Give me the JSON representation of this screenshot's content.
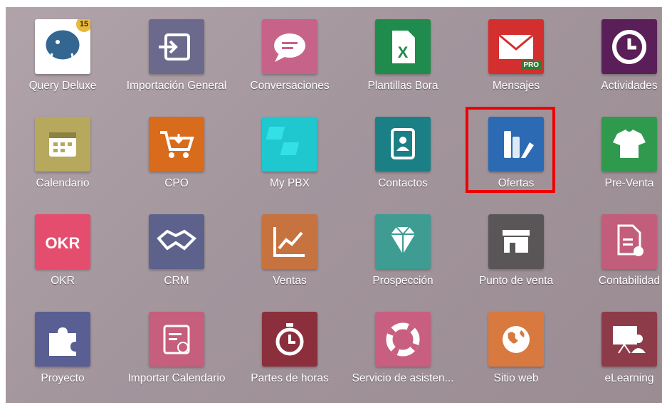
{
  "apps": [
    {
      "label": "Query Deluxe",
      "icon": "postgres-elephant-icon",
      "color": "#ffffff",
      "badge": "15"
    },
    {
      "label": "Importación General",
      "icon": "import-icon",
      "color": "#6b6a8d"
    },
    {
      "label": "Conversaciones",
      "icon": "chat-bubble-icon",
      "color": "#c76388"
    },
    {
      "label": "Plantillas Bora",
      "icon": "excel-file-icon",
      "color": "#1f8b4c"
    },
    {
      "label": "Mensajes",
      "icon": "envelope-icon",
      "color": "#d32f2f",
      "badge_text": "PRO"
    },
    {
      "label": "Actividades",
      "icon": "clock-icon",
      "color": "#5a1e58"
    },
    {
      "label": "Calendario",
      "icon": "calendar-icon",
      "color": "#b6a85d"
    },
    {
      "label": "CPO",
      "icon": "cart-icon",
      "color": "#d96b1c"
    },
    {
      "label": "My PBX",
      "icon": "pbx-logo-icon",
      "color": "#1fc7cf"
    },
    {
      "label": "Contactos",
      "icon": "address-book-icon",
      "color": "#1b7f86"
    },
    {
      "label": "Ofertas",
      "icon": "offers-icon",
      "color": "#2c6ab3"
    },
    {
      "label": "Pre-Venta",
      "icon": "tshirt-icon",
      "color": "#2f9a4d"
    },
    {
      "label": "OKR",
      "icon": "okr-logo-icon",
      "color": "#e54d6e"
    },
    {
      "label": "CRM",
      "icon": "handshake-icon",
      "color": "#5c628c"
    },
    {
      "label": "Ventas",
      "icon": "chart-up-icon",
      "color": "#c7733f"
    },
    {
      "label": "Prospección",
      "icon": "diamond-icon",
      "color": "#3e9c93"
    },
    {
      "label": "Punto de venta",
      "icon": "store-icon",
      "color": "#5a5658"
    },
    {
      "label": "Contabilidad",
      "icon": "invoice-gear-icon",
      "color": "#c25d7c"
    },
    {
      "label": "Proyecto",
      "icon": "puzzle-icon",
      "color": "#595f92"
    },
    {
      "label": "Importar Calendario",
      "icon": "calendar-import-icon",
      "color": "#c65e7e"
    },
    {
      "label": "Partes de horas",
      "icon": "stopwatch-icon",
      "color": "#8b2f3d"
    },
    {
      "label": "Servicio de asisten...",
      "icon": "lifebuoy-icon",
      "color": "#c95f80"
    },
    {
      "label": "Sitio web",
      "icon": "globe-icon",
      "color": "#d8793f"
    },
    {
      "label": "eLearning",
      "icon": "elearning-icon",
      "color": "#8e3b49"
    }
  ],
  "highlighted_app": "Ofertas"
}
